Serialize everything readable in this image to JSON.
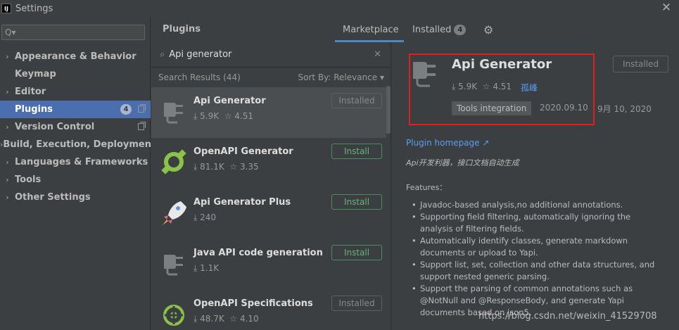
{
  "window": {
    "title": "Settings",
    "logo_text": "IJ",
    "close_icon": "close-icon"
  },
  "sidebar": {
    "search_placeholder": "Q▾",
    "items": [
      {
        "label": "Appearance & Behavior",
        "arrow": "›",
        "badge": "",
        "copy": false,
        "selected": false
      },
      {
        "label": "Keymap",
        "arrow": "",
        "badge": "",
        "copy": false,
        "selected": false
      },
      {
        "label": "Editor",
        "arrow": "›",
        "badge": "",
        "copy": false,
        "selected": false
      },
      {
        "label": "Plugins",
        "arrow": "",
        "badge": "4",
        "copy": true,
        "selected": true
      },
      {
        "label": "Version Control",
        "arrow": "›",
        "badge": "",
        "copy": true,
        "selected": false
      },
      {
        "label": "Build, Execution, Deployment",
        "arrow": "›",
        "badge": "",
        "copy": false,
        "selected": false
      },
      {
        "label": "Languages & Frameworks",
        "arrow": "›",
        "badge": "",
        "copy": false,
        "selected": false
      },
      {
        "label": "Tools",
        "arrow": "›",
        "badge": "",
        "copy": false,
        "selected": false
      },
      {
        "label": "Other Settings",
        "arrow": "›",
        "badge": "",
        "copy": false,
        "selected": false
      }
    ]
  },
  "header": {
    "title": "Plugins",
    "tabs": {
      "marketplace": "Marketplace",
      "installed": "Installed",
      "installed_count": "4"
    }
  },
  "list": {
    "query": "Api generator",
    "results_label": "Search Results (44)",
    "sort_label": "Sort By: Relevance ▾",
    "plugins": [
      {
        "name": "Api Generator",
        "downloads": "5.9K",
        "rating": "4.51",
        "button": "Installed",
        "selected": true
      },
      {
        "name": "OpenAPI Generator",
        "downloads": "81.1K",
        "rating": "3.35",
        "button": "Install",
        "selected": false
      },
      {
        "name": "Api Generator Plus",
        "downloads": "240",
        "rating": "",
        "button": "Install",
        "selected": false
      },
      {
        "name": "Java API code generation",
        "downloads": "1.1K",
        "rating": "",
        "button": "Install",
        "selected": false
      },
      {
        "name": "OpenAPI Specifications",
        "downloads": "48.7K",
        "rating": "4.10",
        "button": "Installed",
        "selected": false
      }
    ]
  },
  "details": {
    "name": "Api Generator",
    "downloads": "5.9K",
    "rating": "4.51",
    "vendor": "孤峰",
    "tag": "Tools integration",
    "version": "2020.09.10",
    "date": "9月 10, 2020",
    "installed_button": "Installed",
    "homepage": "Plugin homepage ↗",
    "description": "Api开发利器，接口文档自动生成",
    "features_title": "Features：",
    "features": [
      "Javadoc-based analysis,no additional annotations.",
      "Supporting field filtering, automatically ignoring the analysis of filtering fields.",
      "Automatically identify classes, generate markdown documents or upload to Yapi.",
      "Support list, set, collection and other data structures, and support nested generic parsing.",
      "Support the parsing of common annotations such as @NotNull and @ResponseBody, and generate Yapi documents based on json5."
    ]
  },
  "watermark": "https://blog.csdn.net/weixin_41529708",
  "colors": {
    "background": "#3c3f41",
    "selection": "#4b6eaf",
    "link": "#589df6",
    "install_green": "#6ab07d",
    "highlight_red": "#e02020"
  }
}
